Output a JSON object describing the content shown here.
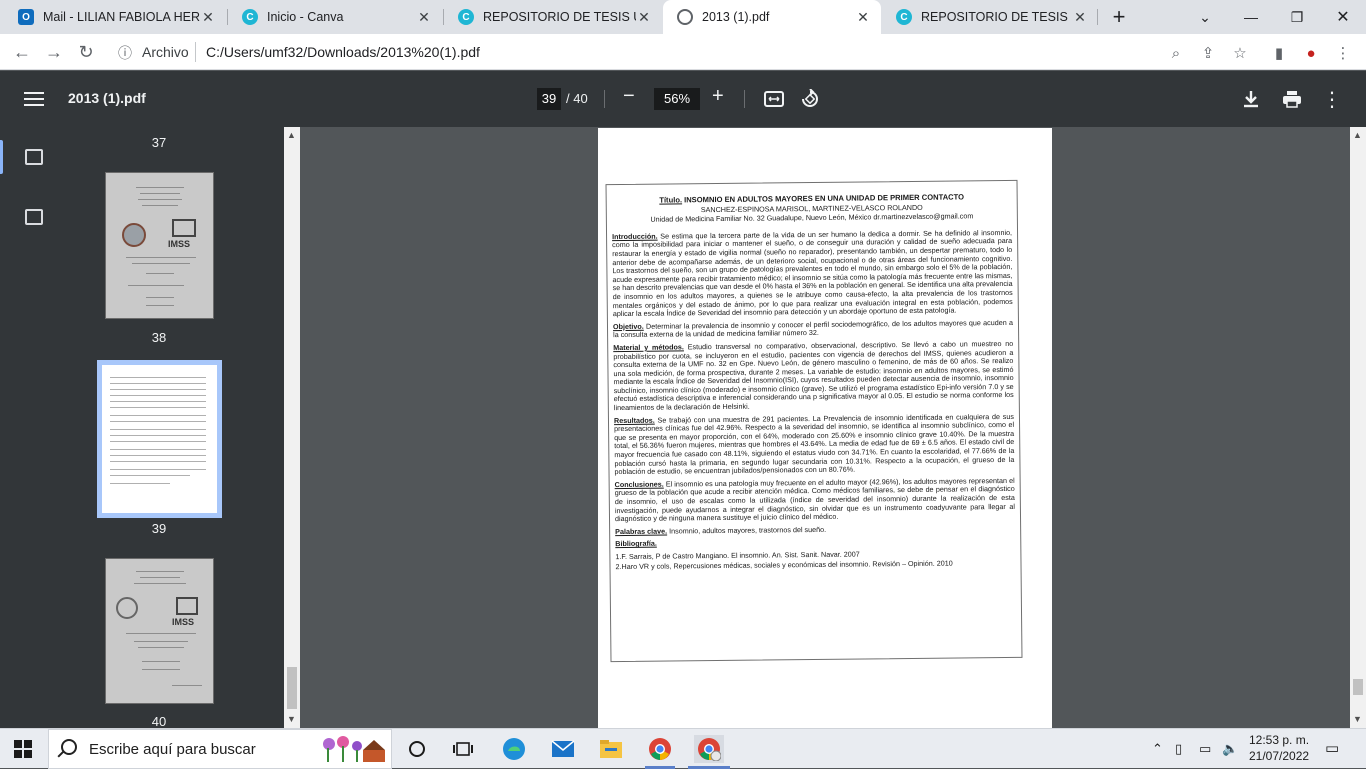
{
  "browser": {
    "tabs": [
      {
        "title": "Mail - LILIAN FABIOLA HERN...",
        "icon": "outlook-icon",
        "active": false
      },
      {
        "title": "Inicio - Canva",
        "icon": "canva-icon",
        "active": false
      },
      {
        "title": "REPOSITORIO DE TESIS UMF",
        "icon": "canva-icon",
        "active": false
      },
      {
        "title": "2013 (1).pdf",
        "icon": "globe-icon",
        "active": true
      },
      {
        "title": "REPOSITORIO DE TESIS UMF",
        "icon": "canva-icon",
        "active": false
      }
    ],
    "new_tab": "+",
    "address": {
      "scheme_label": "Archivo",
      "url": "C:/Users/umf32/Downloads/2013%20(1).pdf"
    }
  },
  "pdf": {
    "title": "2013 (1).pdf",
    "current_page": "39",
    "total_pages": "/ 40",
    "zoom": "56%",
    "thumbnails": [
      {
        "num": "37"
      },
      {
        "num": "38"
      },
      {
        "num": "39"
      },
      {
        "num": "40"
      }
    ],
    "document": {
      "title_label": "Título.",
      "title": "INSOMNIO EN ADULTOS MAYORES EN UNA UNIDAD DE PRIMER CONTACTO",
      "authors": "SANCHEZ-ESPINOSA MARISOL, MARTINEZ-VELASCO ROLANDO",
      "affiliation": "Unidad de Medicina Familiar No. 32 Guadalupe, Nuevo León, México  dr.martinezvelasco@gmail.com",
      "sections": [
        {
          "label": "Introducción.",
          "text": "Se estima que la tercera parte de la vida de un ser humano la dedica a dormir. Se ha definido al insomnio, como la imposibilidad para iniciar o mantener el sueño, o de conseguir una duración y calidad de sueño adecuada para restaurar la energía y estado de vigilia normal (sueño no reparador), presentando también, un despertar prematuro, todo lo anterior debe de acompañarse además, de un deterioro social, ocupacional o de otras áreas del funcionamiento cognitivo. Los trastornos del sueño, son un grupo de patologías prevalentes en todo el mundo, sin embargo solo el 5% de la población, acude expresamente para recibir tratamiento médico; el insomnio se sitúa como la patología más frecuente entre las mismas, se han descrito prevalencias que van desde el 0% hasta el 36% en la población en general. Se identifica una alta prevalencia de insomnio en los adultos mayores, a quienes se le atribuye como causa-efecto, la alta prevalencia de los trastornos mentales orgánicos y del estado de ánimo, por lo que para realizar una evaluación integral en esta población, podemos aplicar la escala Índice de Severidad del insomnio para detección y un abordaje oportuno de esta patología."
        },
        {
          "label": "Objetivo.",
          "text": "Determinar la prevalencia de insomnio y conocer el perfil sociodemográfico, de los adultos mayores que acuden a la consulta externa de la unidad de medicina familiar número 32."
        },
        {
          "label": "Material y métodos.",
          "text": "Estudio transversal no comparativo, observacional, descriptivo. Se llevó a cabo un muestreo no probabilístico por cuota, se incluyeron en el estudio, pacientes con vigencia de derechos del IMSS, quienes acudieron a consulta externa de la UMF no. 32 en Gpe. Nuevo León, de género masculino o femenino, de más de 60 años. Se realizo una sola medición, de forma prospectiva, durante 2 meses. La variable de estudio: insomnio en adultos mayores, se estimó mediante la escala Índice de Severidad del Insomnio(ISI), cuyos resultados pueden detectar ausencia de insomnio, insomnio subclínico, insomnio clínico (moderado) e insomnio clínico (grave). Se utilizó el programa estadístico Epi-info versión 7.0 y se efectuó estadística descriptiva e inferencial considerando una p significativa mayor al 0.05. El estudio se norma conforme los lineamientos de la declaración de Helsinki."
        },
        {
          "label": "Resultados.",
          "text": "Se trabajó con una muestra de 291 pacientes. La Prevalencia de insomnio identificada en cualquiera de sus presentaciones clínicas fue del 42.96%. Respecto a la severidad del insomnio, se identifica al insomnio subclínico, como el que se presenta en mayor proporción, con el 64%, moderado con 25.60% e insomnio clínico grave 10.40%. De la muestra total, el 56.36% fueron mujeres, mientras que hombres el 43.64%. La media de edad fue de 69 ± 6.5 años. El estado civil de mayor frecuencia fue casado con 48.11%, siguiendo el estatus viudo con 34.71%. En cuanto la escolaridad, el 77.66% de la población cursó hasta la primaria, en segundo lugar secundaria con 10.31%. Respecto a la ocupación, el grueso de la población de estudio, se encuentran jubilados/pensionados con un 80.76%."
        },
        {
          "label": "Conclusiones.",
          "text": "El insomnio es una patología muy frecuente en el adulto mayor (42.96%), los adultos mayores representan el grueso de la población que acude a recibir atención médica. Como médicos familiares, se debe de pensar en el diagnóstico de insomnio, el uso de escalas como la utilizada (índice de severidad del insomnio) durante la realización de esta investigación, puede ayudarnos a integrar el diagnóstico, sin olvidar que es un instrumento coadyuvante para llegar al diagnóstico y de ninguna manera sustituye el juicio clínico del médico."
        },
        {
          "label": "Palabras clave.",
          "text": "Insomnio, adultos mayores, trastornos del sueño."
        }
      ],
      "bibliography_label": "Bibliografía.",
      "bibliography": [
        "1.F. Sarrais, P de Castro Mangiano. El insomnio. An. Sist. Sanit. Navar. 2007",
        "2.Haro VR y cols, Repercusiones médicas, sociales y económicas del insomnio. Revisión – Opinión. 2010"
      ]
    }
  },
  "taskbar": {
    "search_placeholder": "Escribe aquí para buscar",
    "time": "12:53 p. m.",
    "date": "21/07/2022"
  },
  "colors": {
    "pdf_toolbar": "#323639",
    "viewer_bg": "#525659",
    "selection": "#a8c7fa",
    "tabstrip": "#dee1e6"
  }
}
